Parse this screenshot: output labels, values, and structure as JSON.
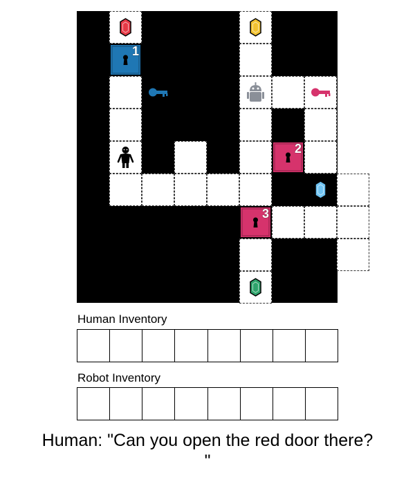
{
  "grid": {
    "cols": 8,
    "rows": 9,
    "floor": [
      [
        1,
        0
      ],
      [
        1,
        1
      ],
      [
        1,
        2
      ],
      [
        1,
        3
      ],
      [
        1,
        4
      ],
      [
        1,
        5
      ],
      [
        2,
        5
      ],
      [
        3,
        5
      ],
      [
        4,
        5
      ],
      [
        5,
        5
      ],
      [
        7,
        2
      ],
      [
        7,
        3
      ],
      [
        7,
        4
      ],
      [
        3,
        4
      ],
      [
        5,
        0
      ],
      [
        5,
        1
      ],
      [
        5,
        2
      ],
      [
        5,
        3
      ],
      [
        5,
        4
      ],
      [
        6,
        2
      ],
      [
        8,
        5
      ],
      [
        8,
        6
      ],
      [
        8,
        7
      ],
      [
        6,
        6
      ],
      [
        7,
        6
      ],
      [
        5,
        7
      ],
      [
        5,
        8
      ]
    ],
    "items": [
      {
        "kind": "gem",
        "color": "#e63946",
        "icon": "red-gem-icon",
        "col": 1,
        "row": 0
      },
      {
        "kind": "gem",
        "color": "#f2c230",
        "icon": "yellow-gem-icon",
        "col": 5,
        "row": 0
      },
      {
        "kind": "gem",
        "color": "#6fc3f2",
        "icon": "blue-gem-icon",
        "col": 7,
        "row": 5
      },
      {
        "kind": "gem",
        "color": "#2ea36b",
        "icon": "green-gem-icon",
        "col": 5,
        "row": 8
      },
      {
        "kind": "key",
        "color": "#1f77b4",
        "icon": "blue-key-icon",
        "col": 2,
        "row": 2
      },
      {
        "kind": "key",
        "color": "#d6336c",
        "icon": "pink-key-icon",
        "col": 7,
        "row": 2
      }
    ],
    "doors": [
      {
        "number": "1",
        "color": "#1f77b4",
        "icon": "blue-door-icon",
        "col": 1,
        "row": 1
      },
      {
        "number": "2",
        "color": "#d6336c",
        "icon": "pink-door-icon",
        "col": 6,
        "row": 4
      },
      {
        "number": "3",
        "color": "#d6336c",
        "icon": "pink-door-icon",
        "col": 5,
        "row": 6
      }
    ],
    "agents": [
      {
        "kind": "robot",
        "icon": "robot-icon",
        "col": 5,
        "row": 2
      },
      {
        "kind": "human",
        "icon": "human-icon",
        "col": 1,
        "row": 4
      }
    ]
  },
  "human_inventory": {
    "label": "Human Inventory",
    "slots": 8
  },
  "robot_inventory": {
    "label": "Robot Inventory",
    "slots": 8
  },
  "speech": "Human: \"Can you open the red door there?\n\""
}
